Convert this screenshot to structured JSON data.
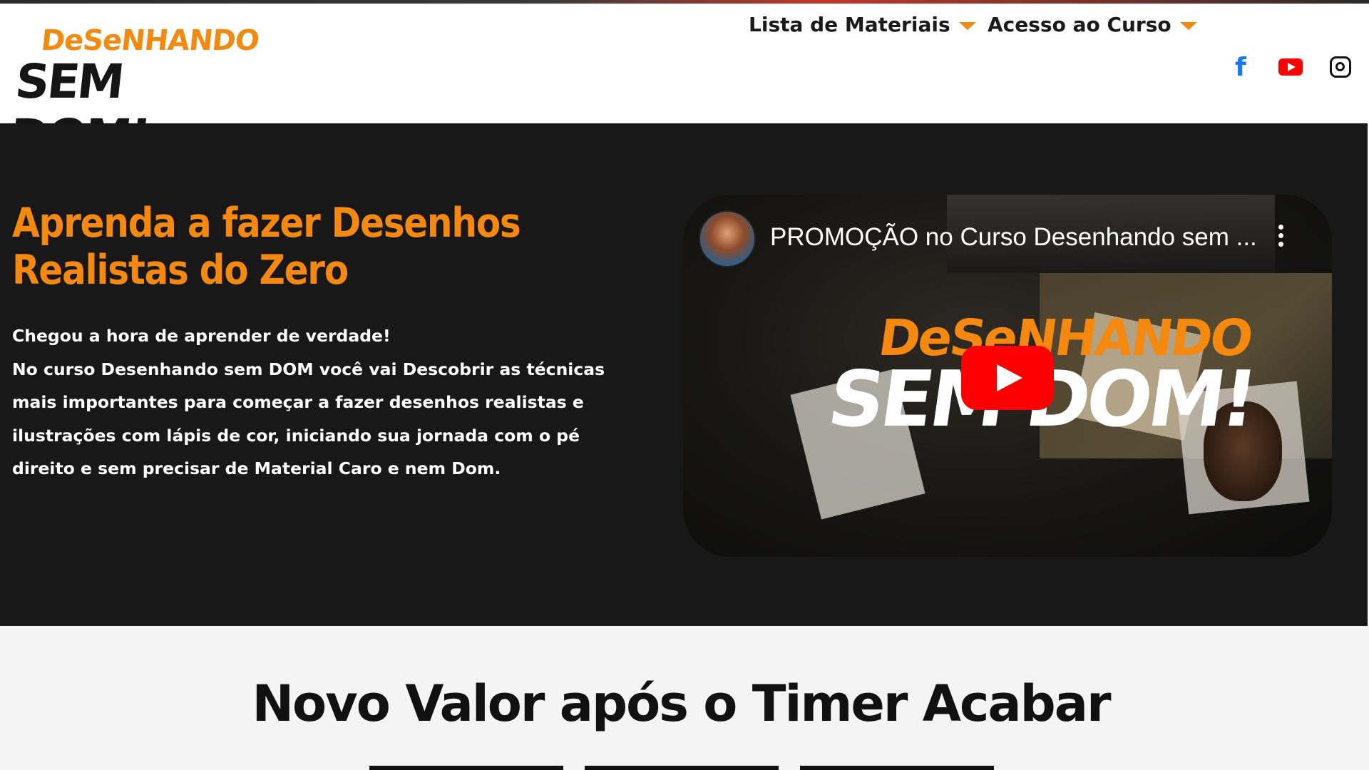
{
  "logo": {
    "line1": "DeSeNHANDO",
    "line2": "SEM DOM!"
  },
  "nav": {
    "items": [
      {
        "label": "Lista de Materiais"
      },
      {
        "label": "Acesso ao Curso"
      }
    ],
    "social": [
      {
        "icon": "facebook-icon",
        "glyph": "f",
        "color": "#1877f2"
      },
      {
        "icon": "youtube-icon",
        "color": "#ff0000"
      },
      {
        "icon": "instagram-icon",
        "color": "#111111"
      }
    ]
  },
  "hero": {
    "title_line1": "Aprenda a fazer Desenhos",
    "title_line2": "Realistas do Zero",
    "lead": "Chegou a hora de aprender de verdade!",
    "body": "No curso Desenhando sem DOM você vai Descobrir as técnicas mais importantes para começar a fazer desenhos realistas e ilustrações com lápis de cor, iniciando sua jornada com o pé direito e sem precisar de Material Caro e nem Dom.",
    "video": {
      "title": "PROMOÇÃO no Curso Desenhando sem ...",
      "brand_line1": "DeSeNHANDO",
      "brand_line2": "SEM DOM!"
    }
  },
  "lower": {
    "title": "Novo Valor após o Timer Acabar"
  },
  "colors": {
    "accent": "#f5890f",
    "hero_bg": "#181818",
    "lower_bg": "#f4f4f4"
  }
}
